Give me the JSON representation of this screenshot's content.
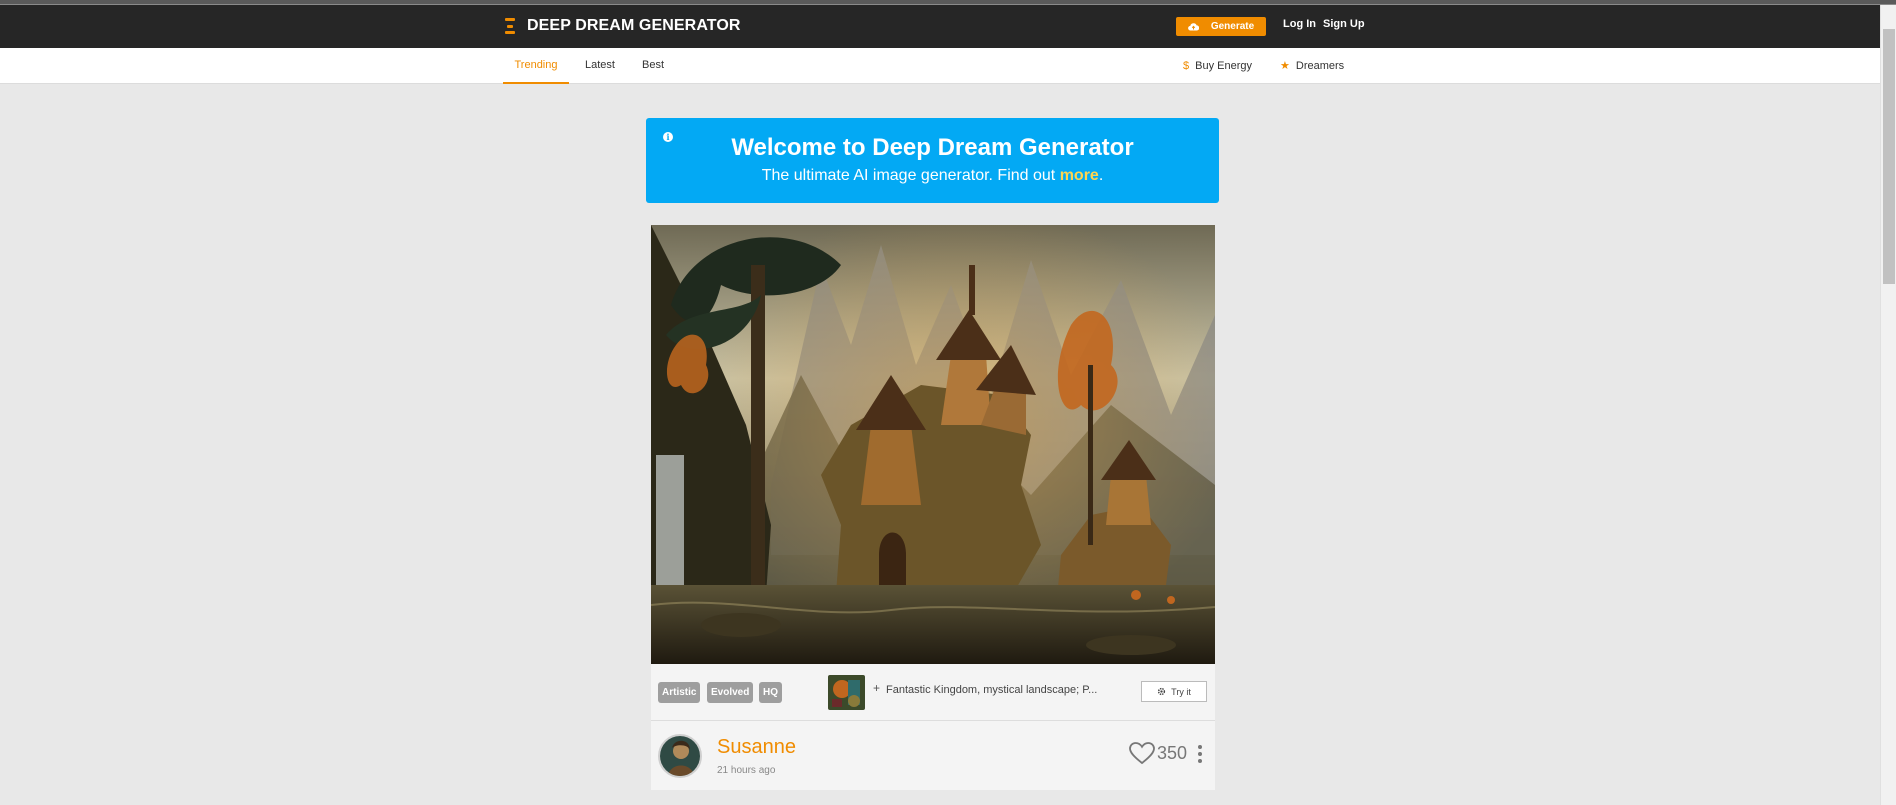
{
  "header": {
    "logo_text": "DEEP DREAM GENERATOR",
    "logo_icon": "hourglass-icon",
    "generate_label": "Generate",
    "login_label": "Log In",
    "signup_label": "Sign Up"
  },
  "subnav": {
    "tabs": [
      {
        "label": "Trending",
        "active": true
      },
      {
        "label": "Latest",
        "active": false
      },
      {
        "label": "Best",
        "active": false
      }
    ],
    "buy_energy_label": "Buy Energy",
    "dreamers_label": "Dreamers"
  },
  "banner": {
    "title": "Welcome to Deep Dream Generator",
    "subtitle_prefix": "The ultimate AI image generator. Find out ",
    "subtitle_link": "more",
    "subtitle_suffix": "."
  },
  "post": {
    "badges": [
      "Artistic",
      "Evolved",
      "HQ"
    ],
    "prompt_text": "Fantastic Kingdom, mystical landscape; P...",
    "try_label": "Try it",
    "author_name": "Susanne",
    "time_ago": "21 hours ago",
    "likes": "350"
  },
  "colors": {
    "accent": "#f08c00",
    "banner_bg": "#03a9f4",
    "topbar_bg": "#262626",
    "page_bg": "#e8e8e8"
  }
}
